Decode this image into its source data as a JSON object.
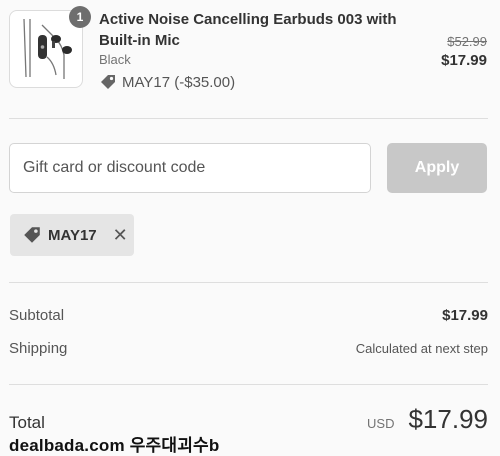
{
  "product": {
    "quantity": "1",
    "name": "Active Noise Cancelling Earbuds 003 with Built-in Mic",
    "variant": "Black",
    "discount_label": "MAY17 (-$35.00)",
    "original_price": "$52.99",
    "price": "$17.99",
    "thumbnail_icon": "earbuds-icon",
    "discount_icon": "price-tag-icon"
  },
  "discount_form": {
    "placeholder": "Gift card or discount code",
    "value": "",
    "apply_label": "Apply"
  },
  "applied_code": {
    "label": "MAY17",
    "tag_icon": "price-tag-icon",
    "remove_icon": "close-icon"
  },
  "summary": {
    "subtotal_label": "Subtotal",
    "subtotal_value": "$17.99",
    "shipping_label": "Shipping",
    "shipping_value": "Calculated at next step",
    "total_label": "Total",
    "currency": "USD",
    "total_value": "$17.99"
  },
  "watermark": "dealbada.com 우주대괴수b",
  "colors": {
    "apply_disabled": "#c8c8c8",
    "chip_background": "#e5e5e5",
    "divider": "#dedede",
    "qty_badge": "#6e6e6e"
  }
}
